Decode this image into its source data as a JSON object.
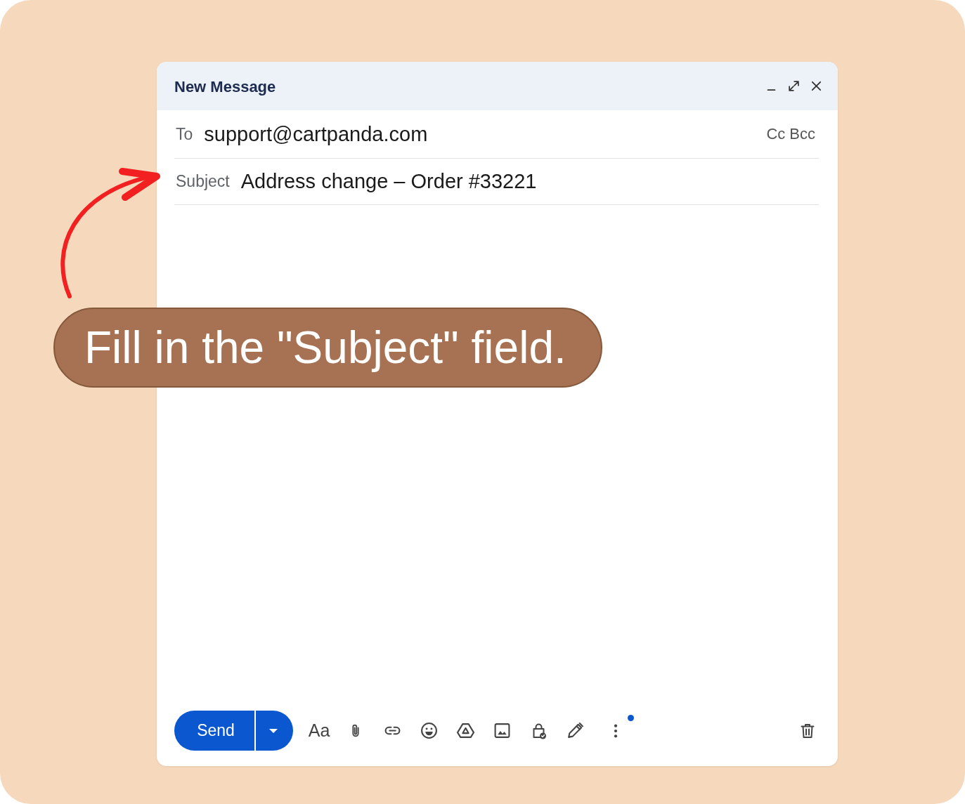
{
  "window": {
    "title": "New Message"
  },
  "to": {
    "label": "To",
    "value": "support@cartpanda.com",
    "cc": "Cc",
    "bcc": "Bcc"
  },
  "subject": {
    "label": "Subject",
    "value": "Address change – Order #33221"
  },
  "toolbar": {
    "send": "Send",
    "format": "Aa",
    "more_notification": true
  },
  "callout": {
    "text": "Fill in the \"Subject\" field."
  }
}
